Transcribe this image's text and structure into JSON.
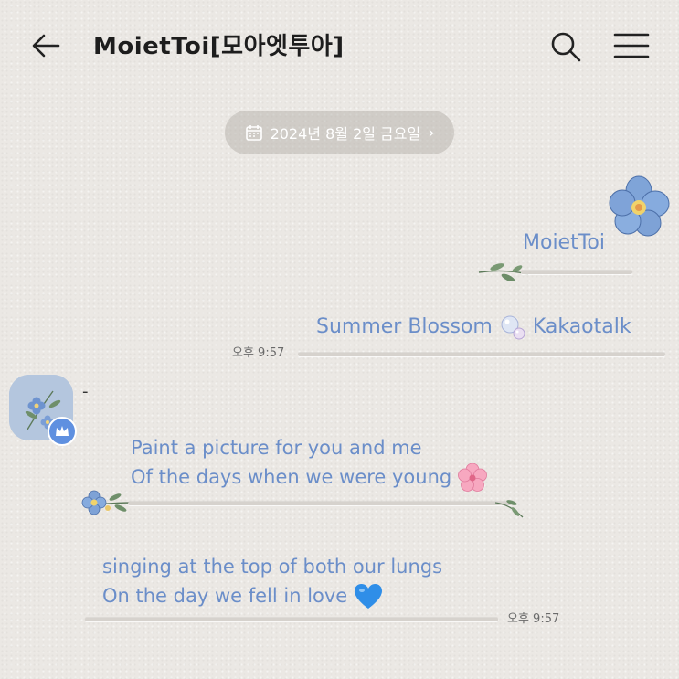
{
  "header": {
    "title": "MoietToi[모아엣투아]",
    "back_icon": "arrow-left-icon",
    "search_icon": "search-icon",
    "menu_icon": "hamburger-menu-icon"
  },
  "date_divider": {
    "label": "2024년 8월 2일 금요일",
    "icon": "calendar-icon",
    "chevron": "›"
  },
  "messages": [
    {
      "direction": "outgoing",
      "lines": [
        "MoietToi"
      ]
    },
    {
      "direction": "outgoing",
      "lines": [
        "Summer Blossom",
        "Kakaotalk"
      ],
      "emoji": "bubbles",
      "time": "오후 9:57"
    },
    {
      "direction": "incoming",
      "sender": "-",
      "lines": [
        "Paint a picture for you and me",
        "Of the days when we were young"
      ],
      "emoji": "cherry-blossom"
    },
    {
      "direction": "incoming",
      "lines": [
        "singing at the top of both our lungs",
        "On the day we fell in love"
      ],
      "emoji": "blue-heart",
      "time": "오후 9:57"
    }
  ],
  "colors": {
    "message_text": "#6b8ec9",
    "background": "#ebe8e4",
    "badge": "#5f90e0"
  }
}
